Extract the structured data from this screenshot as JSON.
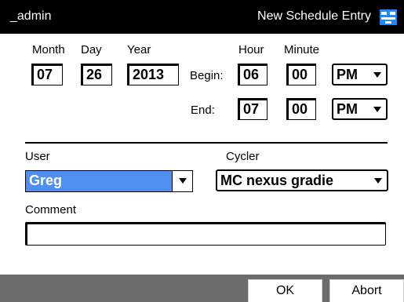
{
  "titlebar": {
    "user": "_admin",
    "title": "New Schedule Entry",
    "icon": "schedule-icon"
  },
  "date": {
    "month_label": "Month",
    "day_label": "Day",
    "year_label": "Year",
    "month": "07",
    "day": "26",
    "year": "2013"
  },
  "time": {
    "hour_label": "Hour",
    "minute_label": "Minute",
    "begin_label": "Begin:",
    "end_label": "End:",
    "begin_hour": "06",
    "begin_minute": "00",
    "begin_ampm": "PM",
    "end_hour": "07",
    "end_minute": "00",
    "end_ampm": "PM"
  },
  "user": {
    "label": "User",
    "value": "Greg"
  },
  "cycler": {
    "label": "Cycler",
    "value": "MC nexus gradie"
  },
  "comment": {
    "label": "Comment",
    "value": ""
  },
  "buttons": {
    "ok": "OK",
    "abort": "Abort"
  },
  "colors": {
    "titlebar": "#000000",
    "selection": "#4f8ff0",
    "footer": "#6b6b6b"
  }
}
